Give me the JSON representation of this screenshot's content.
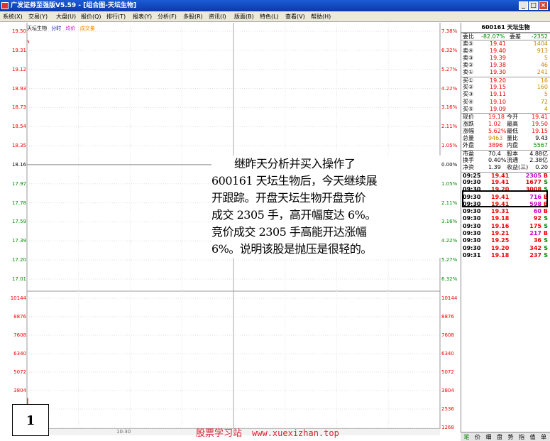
{
  "window": {
    "title": "广发证券至强版V5.59 - [组合图-天坛生物]",
    "buttons": [
      "_",
      "□",
      "×"
    ]
  },
  "menu": [
    "系统(X)",
    "交易(Y)",
    "大盘(U)",
    "报价(Q)",
    "排行(T)",
    "报表(Y)",
    "分析(F)",
    "多股(R)",
    "资讯(I)",
    "版面(B)",
    "特色(L)",
    "查看(V)",
    "帮助(H)"
  ],
  "chart": {
    "legend": {
      "stock": "天坛生物",
      "minute": "分时",
      "avg": "均价",
      "vol": "成交量"
    },
    "price_labels_left": [
      "19.50",
      "19.31",
      "19.12",
      "18.93",
      "18.73",
      "18.54",
      "18.35",
      "18.16",
      "17.97",
      "17.78",
      "17.59",
      "17.39",
      "17.20",
      "17.01"
    ],
    "pct_labels_right": [
      "7.38%",
      "6.32%",
      "5.27%",
      "4.22%",
      "3.16%",
      "2.11%",
      "1.05%",
      "0.00%",
      "1.05%",
      "2.11%",
      "3.16%",
      "4.22%",
      "5.27%",
      "6.32%"
    ],
    "vol_labels_left": [
      "10144",
      "8876",
      "7608",
      "6340",
      "5072",
      "3804",
      "2536",
      "1268"
    ],
    "vol_labels_right": [
      "10144",
      "8876",
      "7608",
      "6340",
      "5072",
      "3804",
      "2536",
      "1268"
    ],
    "time_label": "10:30"
  },
  "chart_data": {
    "type": "line",
    "price_axis": [
      17.01,
      19.5
    ],
    "volume_axis": [
      0,
      10144
    ],
    "series": [
      {
        "x": [
          "09:30"
        ],
        "values": [
          19.41
        ]
      }
    ],
    "opening_volume": 2305
  },
  "annotation": {
    "lines": [
      "继昨天分析并买入操作了",
      "600161 天坛生物后，今天继续展",
      "开跟踪。开盘天坛生物开盘竞价",
      "成交 2305 手，高开幅度达 6%。",
      "竞价成交 2305 手高能开达涨幅",
      "6%。说明该股是抛压是很轻的。"
    ]
  },
  "figure_number": "1",
  "credit": {
    "site": "股票学习站",
    "url": "www.xuexizhan.top"
  },
  "panel": {
    "header": "600161 天坛生物",
    "ratio": {
      "l1": "委比",
      "v1": "-82.07%",
      "l2": "委差",
      "v2": "-2352"
    },
    "asks": [
      {
        "label": "卖⑤",
        "price": "19.41",
        "vol": "1404"
      },
      {
        "label": "卖④",
        "price": "19.40",
        "vol": "913"
      },
      {
        "label": "卖③",
        "price": "19.39",
        "vol": "5"
      },
      {
        "label": "卖②",
        "price": "19.38",
        "vol": "46"
      },
      {
        "label": "卖①",
        "price": "19.30",
        "vol": "241"
      }
    ],
    "bids": [
      {
        "label": "买①",
        "price": "19.20",
        "vol": "16"
      },
      {
        "label": "买②",
        "price": "19.15",
        "vol": "160"
      },
      {
        "label": "买③",
        "price": "19.11",
        "vol": "5"
      },
      {
        "label": "买④",
        "price": "19.10",
        "vol": "72"
      },
      {
        "label": "买⑤",
        "price": "19.09",
        "vol": "4"
      }
    ],
    "stats": [
      {
        "l1": "现价",
        "v1": "19.18",
        "l2": "今开",
        "v2": "19.41"
      },
      {
        "l1": "涨跌",
        "v1": "1.02",
        "l2": "最高",
        "v2": "19.50"
      },
      {
        "l1": "涨幅",
        "v1": "5.62%",
        "l2": "最低",
        "v2": "19.15"
      },
      {
        "l1": "总量",
        "v1": "9463",
        "l2": "量比",
        "v2": "9.43"
      },
      {
        "l1": "外盘",
        "v1": "3896",
        "l2": "内盘",
        "v2": "5567"
      }
    ],
    "fund": [
      {
        "l1": "市盈",
        "v1": "70.4",
        "l2": "股本",
        "v2": "4.88亿"
      },
      {
        "l1": "换手",
        "v1": "0.40%",
        "l2": "流通",
        "v2": "2.38亿"
      },
      {
        "l1": "净资",
        "v1": "1.39",
        "l2": "收益(三)",
        "v2": "0.20"
      }
    ],
    "ticks": [
      {
        "time": "09:25",
        "price": "19.41",
        "vol": "2305",
        "dir": "B"
      },
      {
        "time": "09:30",
        "price": "19.41",
        "vol": "1677",
        "dir": "S"
      },
      {
        "time": "09:30",
        "price": "19.20",
        "vol": "3008",
        "dir": "S"
      },
      {
        "time": "09:30",
        "price": "19.41",
        "vol": "716",
        "dir": "B"
      },
      {
        "time": "09:30",
        "price": "19.41",
        "vol": "598",
        "dir": "B"
      },
      {
        "time": "09:30",
        "price": "19.31",
        "vol": "60",
        "dir": "B"
      },
      {
        "time": "09:30",
        "price": "19.18",
        "vol": "92",
        "dir": "S"
      },
      {
        "time": "09:30",
        "price": "19.16",
        "vol": "175",
        "dir": "S"
      },
      {
        "time": "09:30",
        "price": "19.21",
        "vol": "217",
        "dir": "B"
      },
      {
        "time": "09:30",
        "price": "19.25",
        "vol": "36",
        "dir": "S"
      },
      {
        "time": "09:30",
        "price": "19.20",
        "vol": "342",
        "dir": "S"
      },
      {
        "time": "09:31",
        "price": "19.18",
        "vol": "237",
        "dir": "S"
      }
    ],
    "tabs": [
      "笔",
      "价",
      "细",
      "盘",
      "势",
      "指",
      "值",
      "单"
    ]
  }
}
